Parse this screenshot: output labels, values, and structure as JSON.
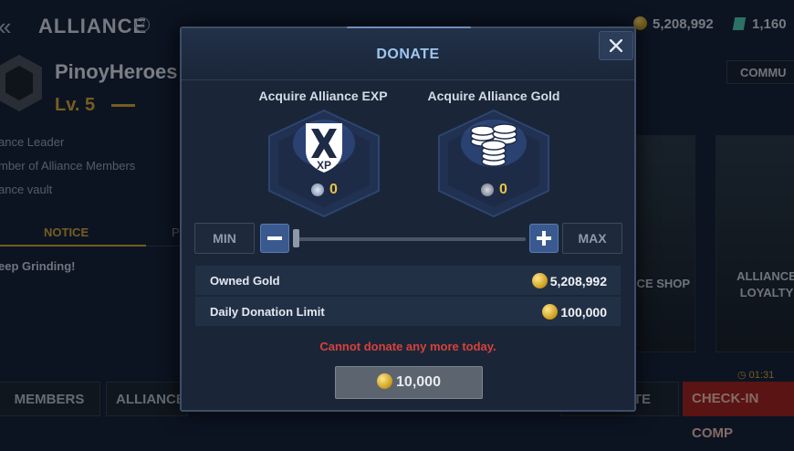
{
  "background": {
    "title": "ALLIANCE",
    "help_icon": "?",
    "gold_amount": "5,208,992",
    "gem_amount": "1,160",
    "alliance_name": "PinoyHeroes",
    "alliance_level": "Lv. 5",
    "info_lines": [
      "ance Leader",
      "mber of Alliance Members",
      "ance vault"
    ],
    "tab_notice": "NOTICE",
    "tab_other": "P",
    "notice_text": "eep Grinding!",
    "community_label": "COMMU",
    "card_shop_label": "ICE SHOP",
    "card_loyalty_label_1": "ALLIANCE",
    "card_loyalty_label_2": "LOYALTY",
    "timer": "01:31",
    "members_button": "MEMBERS",
    "alliance_button": "ALLIANCE",
    "donate_partial": "TE",
    "checkin_button": "CHECK-IN COMP"
  },
  "modal": {
    "title": "DONATE",
    "close_icon": "close-icon",
    "exp_title": "Acquire Alliance EXP",
    "exp_value": "0",
    "exp_badge": "XP",
    "gold_title": "Acquire Alliance Gold",
    "gold_value": "0",
    "min_label": "MIN",
    "max_label": "MAX",
    "slider_value": 0,
    "owned_gold_label": "Owned Gold",
    "owned_gold_value": "5,208,992",
    "daily_limit_label": "Daily Donation Limit",
    "daily_limit_value": "100,000",
    "warning": "Cannot donate any more today.",
    "donate_amount": "10,000"
  },
  "colors": {
    "accent_gold": "#e8c444",
    "warning_red": "#d9403a",
    "modal_bg": "#1a2638",
    "checkin_red": "#a32523"
  }
}
